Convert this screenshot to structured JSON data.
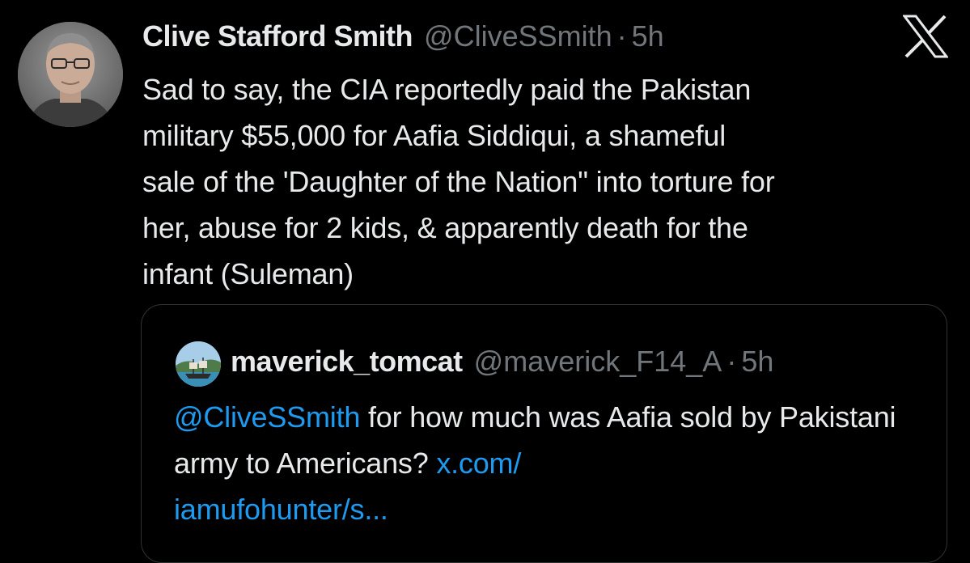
{
  "tweet": {
    "display_name": "Clive Stafford Smith",
    "handle": "@CliveSSmith",
    "separator": "·",
    "time": "5h",
    "text": "Sad to say, the CIA reportedly paid the Pakistan\nmilitary $55,000 for Aafia Siddiqui, a shameful\nsale of the 'Daughter of the Nation\" into torture for\nher, abuse for  2 kids, & apparently death for the\ninfant (Suleman)"
  },
  "quote": {
    "display_name": "maverick_tomcat",
    "handle": "@maverick_F14_A",
    "separator": "·",
    "time": "5h",
    "mention": "@CliveSSmith",
    "text": " for how much was Aafia sold by Pakistani army to Americans? ",
    "link_line1": "x.com/",
    "link_line2": "iamufohunter/s..."
  },
  "icons": {
    "brand": "x-logo-icon",
    "avatar": "avatar",
    "quote_avatar": "quote-avatar"
  },
  "colors": {
    "background": "#000000",
    "text": "#e7e9ea",
    "secondary": "#71767b",
    "link": "#1d9bf0",
    "border": "#2f3336"
  }
}
